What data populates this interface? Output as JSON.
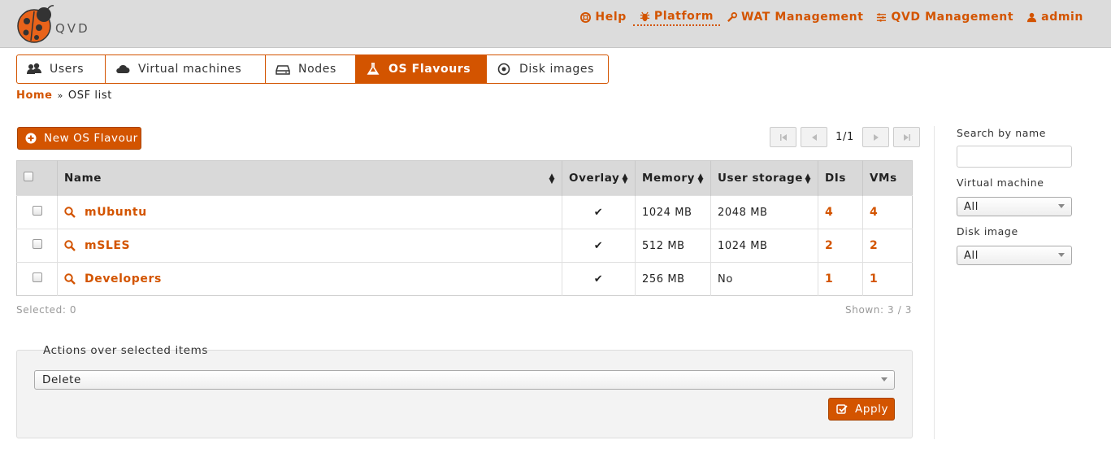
{
  "header": {
    "logo_text": "QVD",
    "nav": [
      {
        "label": "Help",
        "icon": "lifebuoy-icon"
      },
      {
        "label": "Platform",
        "icon": "bug-icon",
        "active": true
      },
      {
        "label": "WAT Management",
        "icon": "wrench-icon"
      },
      {
        "label": "QVD Management",
        "icon": "sliders-icon"
      },
      {
        "label": "admin",
        "icon": "user-icon"
      }
    ]
  },
  "tabs": [
    {
      "label": "Users",
      "icon": "users-icon"
    },
    {
      "label": "Virtual machines",
      "icon": "cloud-icon"
    },
    {
      "label": "Nodes",
      "icon": "hdd-icon"
    },
    {
      "label": "OS Flavours",
      "icon": "flask-icon",
      "active": true
    },
    {
      "label": "Disk images",
      "icon": "disc-icon"
    }
  ],
  "breadcrumb": {
    "home": "Home",
    "current": "OSF list"
  },
  "toolbar": {
    "new_label": "New OS Flavour"
  },
  "pager": {
    "info": "1/1"
  },
  "table": {
    "headers": {
      "name": "Name",
      "overlay": "Overlay",
      "memory": "Memory",
      "user_storage": "User storage",
      "dis": "DIs",
      "vms": "VMs"
    },
    "rows": [
      {
        "name": "mUbuntu",
        "overlay": "✔",
        "memory": "1024 MB",
        "user_storage": "2048 MB",
        "dis": "4",
        "vms": "4"
      },
      {
        "name": "mSLES",
        "overlay": "✔",
        "memory": "512 MB",
        "user_storage": "1024 MB",
        "dis": "2",
        "vms": "2"
      },
      {
        "name": "Developers",
        "overlay": "✔",
        "memory": "256 MB",
        "user_storage": "No",
        "dis": "1",
        "vms": "1"
      }
    ]
  },
  "footer": {
    "selected": "Selected: 0",
    "shown": "Shown: 3 / 3"
  },
  "actions": {
    "legend": "Actions over selected items",
    "selected_action": "Delete",
    "apply_label": "Apply"
  },
  "sidebar": {
    "search_label": "Search by name",
    "search_value": "",
    "vm_label": "Virtual machine",
    "vm_value": "All",
    "di_label": "Disk image",
    "di_value": "All"
  },
  "colors": {
    "accent": "#d35400",
    "header_bg": "#dcdcdc"
  }
}
